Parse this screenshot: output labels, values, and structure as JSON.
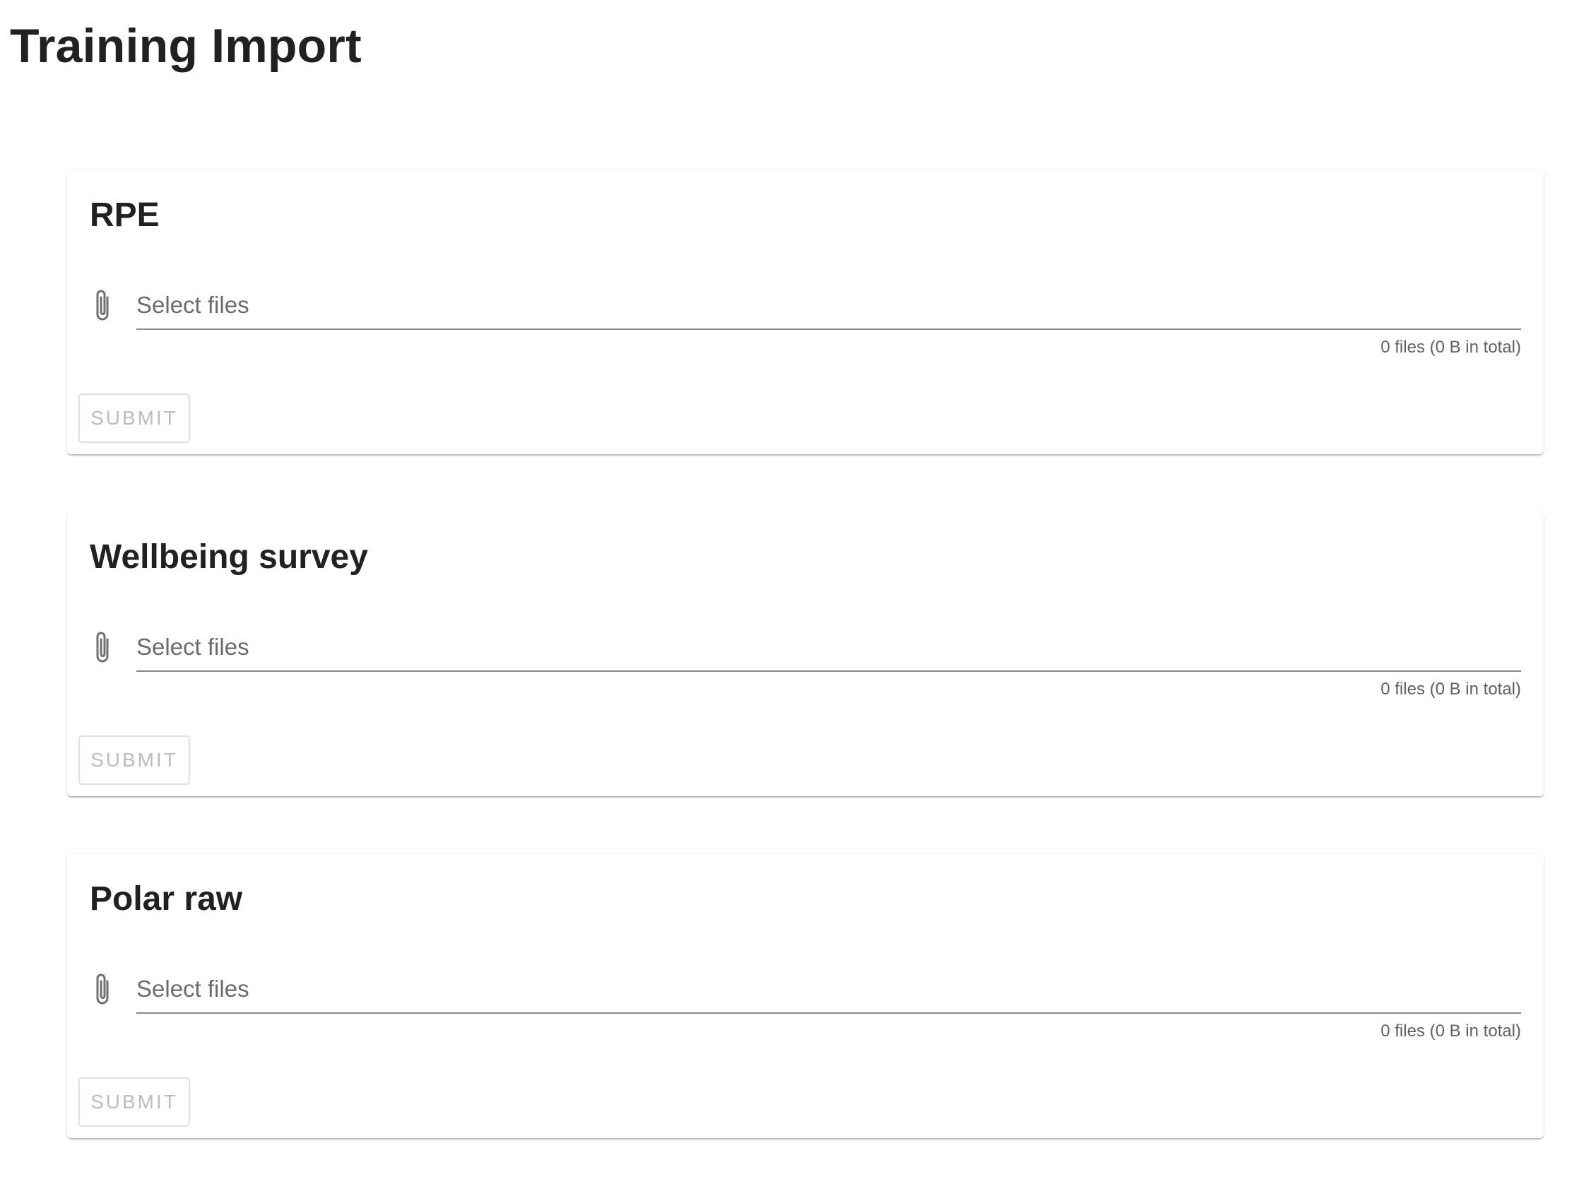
{
  "page": {
    "title": "Training Import"
  },
  "icons": {
    "attachment": "paperclip-icon"
  },
  "colors": {
    "text": "#212121",
    "placeholder": "#6b6b6b",
    "disabled_button_text": "#bdbdbd",
    "underline": "#8a8a8a"
  },
  "cards": [
    {
      "title": "RPE",
      "file_placeholder": "Select files",
      "file_summary": "0 files (0 B in total)",
      "submit_label": "SUBMIT",
      "submit_disabled": true
    },
    {
      "title": "Wellbeing survey",
      "file_placeholder": "Select files",
      "file_summary": "0 files (0 B in total)",
      "submit_label": "SUBMIT",
      "submit_disabled": true
    },
    {
      "title": "Polar raw",
      "file_placeholder": "Select files",
      "file_summary": "0 files (0 B in total)",
      "submit_label": "SUBMIT",
      "submit_disabled": true
    }
  ]
}
